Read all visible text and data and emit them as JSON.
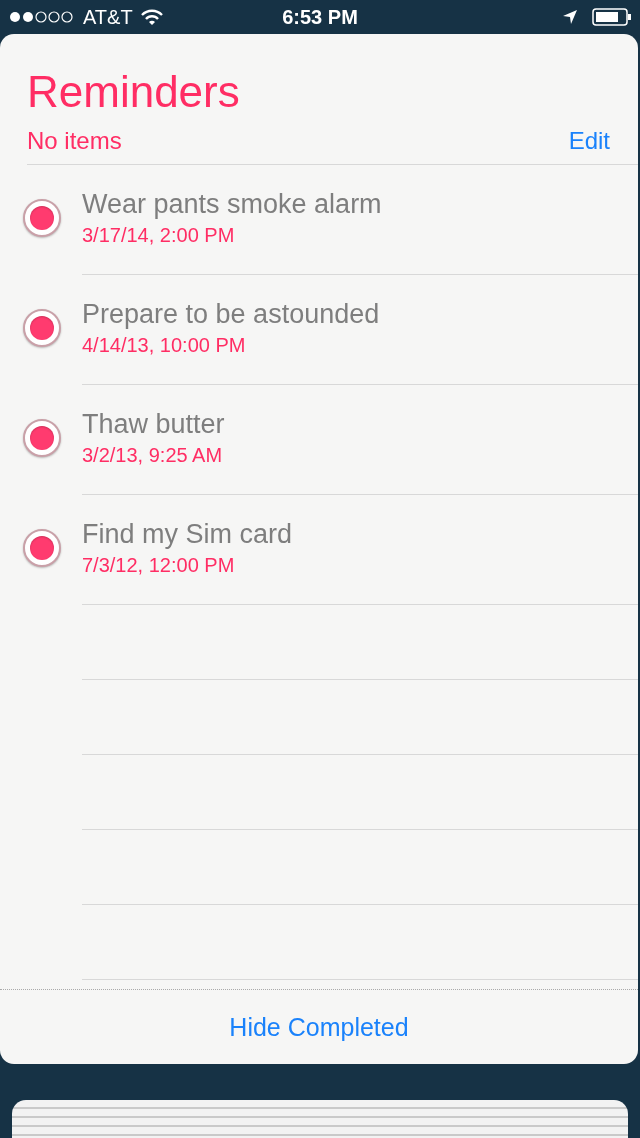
{
  "status_bar": {
    "carrier": "AT&T",
    "time": "6:53 PM"
  },
  "list": {
    "title": "Reminders",
    "subtitle": "No items",
    "edit": "Edit"
  },
  "reminders": [
    {
      "title": "Wear pants smoke alarm",
      "due": "3/17/14, 2:00 PM",
      "completed": true
    },
    {
      "title": "Prepare to be astounded",
      "due": "4/14/13, 10:00 PM",
      "completed": true
    },
    {
      "title": "Thaw butter",
      "due": "3/2/13, 9:25 AM",
      "completed": true
    },
    {
      "title": "Find my Sim card",
      "due": "7/3/12, 12:00 PM",
      "completed": true
    }
  ],
  "footer": {
    "action": "Hide Completed"
  }
}
